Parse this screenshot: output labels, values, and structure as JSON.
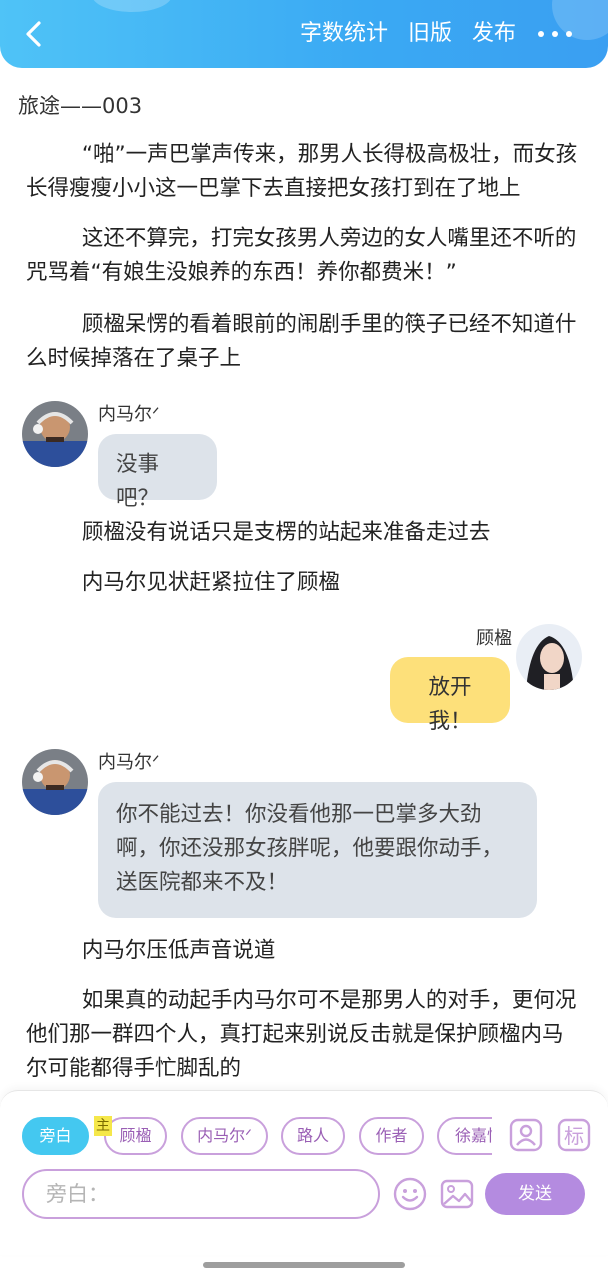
{
  "header": {
    "links": [
      "字数统计",
      "旧版",
      "发布"
    ]
  },
  "story": {
    "title": "旅途——003",
    "paragraphs": [
      "“啪”一声巴掌声传来，那男人长得极高极壮，而女孩长得瘦瘦小小这一巴掌下去直接把女孩打到在了地上",
      "这还不算完，打完女孩男人旁边的女人嘴里还不听的咒骂着“有娘生没娘养的东西！养你都费米！”",
      "顾楹呆愣的看着眼前的闹剧手里的筷子已经不知道什么时候掉落在了桌子上",
      "顾楹没有说话只是支楞的站起来准备走过去",
      "内马尔见状赶紧拉住了顾楹",
      "内马尔压低声音说道",
      "如果真的动起手内马尔可不是那男人的对手，更何况他们那一群四个人，真打起来别说反击就是保护顾楹内马尔可能都得手忙脚乱的"
    ],
    "messages": [
      {
        "name": "内马尔ᐟ",
        "text": "没事吧？"
      },
      {
        "name": "顾楹",
        "text": "放开我！"
      },
      {
        "name": "内马尔ᐟ",
        "text": "你不能过去！你没看他那一巴掌多大劲啊，你还没那女孩胖呢，他要跟你动手，送医院都来不及！"
      }
    ]
  },
  "composer": {
    "roles": [
      "旁白",
      "顾楹",
      "内马尔ᐟ",
      "路人",
      "作者",
      "徐嘉怡"
    ],
    "active_role": "旁白",
    "main_badge": "主",
    "input_placeholder": "旁白：",
    "send_label": "发送",
    "colors": {
      "active": "#44c8f0",
      "outline": "#c9a0dc",
      "send": "#b48be0"
    }
  }
}
